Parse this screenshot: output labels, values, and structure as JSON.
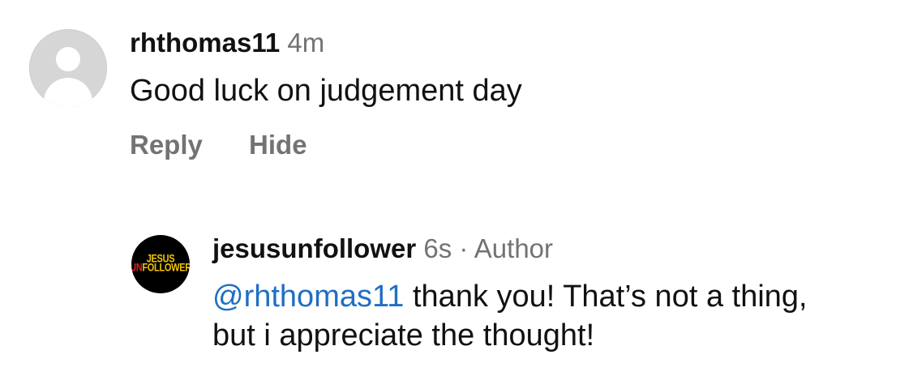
{
  "comments": [
    {
      "username": "rhthomas11",
      "time": "4m",
      "text": "Good luck on judgement day",
      "actions": {
        "reply": "Reply",
        "hide": "Hide"
      },
      "avatar": "default-user-avatar-icon"
    },
    {
      "username": "jesusunfollower",
      "time": "6s",
      "separator": "·",
      "badge": "Author",
      "mention": "@rhthomas11",
      "text_after_mention": " thank you! That’s not a thing,",
      "text_line2": "but i appreciate the thought!",
      "avatar": {
        "logo_line1": "JESUS",
        "logo_line2_prefix": "UN",
        "logo_line2_rest": "FOLLOWER",
        "logo_bg": "#000000",
        "logo_color": "#f5c400",
        "logo_accent": "#e02020"
      }
    }
  ],
  "colors": {
    "text": "#111111",
    "muted": "#737373",
    "mention": "#1f6fc4"
  }
}
